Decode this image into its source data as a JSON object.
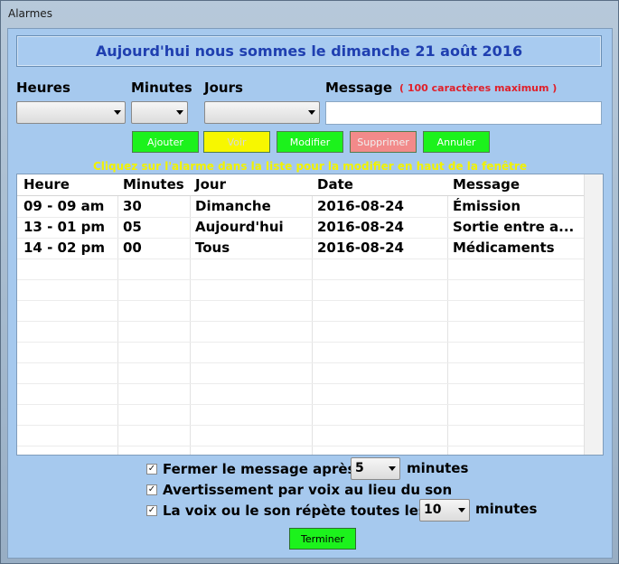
{
  "window": {
    "title": "Alarmes"
  },
  "banner": "Aujourd'hui nous sommes le dimanche 21 août 2016",
  "labels": {
    "heures": "Heures",
    "minutes": "Minutes",
    "jours": "Jours",
    "message": "Message",
    "hint": "( 100 caractères maximum )"
  },
  "buttons": {
    "ajouter": "Ajouter",
    "voir": "Voir",
    "modifier": "Modifier",
    "supprimer": "Supprimer",
    "annuler": "Annuler",
    "terminer": "Terminer"
  },
  "note": "Cliquez sur l'alarme dans la liste pour la modifier en haut de la fenêtre",
  "table": {
    "headers": [
      "Heure",
      "Minutes",
      "Jour",
      "Date",
      "Message"
    ],
    "rows": [
      [
        "09 - 09 am",
        "30",
        "Dimanche",
        "2016-08-24",
        "Émission"
      ],
      [
        "13 - 01 pm",
        "05",
        "Aujourd'hui",
        "2016-08-24",
        "Sortie entre a..."
      ],
      [
        "14 - 02 pm",
        "00",
        "Tous",
        "2016-08-24",
        "Médicaments"
      ]
    ]
  },
  "options": {
    "close_after": "Fermer le message après",
    "close_after_value": "5",
    "voice": "Avertissement par voix au lieu du son",
    "repeat": "La voix ou le son répète toutes les",
    "repeat_value": "10",
    "minutes_unit": "minutes"
  },
  "colors": {
    "banner_text": "#1f3fb0",
    "accent_green": "#1cf21c",
    "hint_red": "#e0202a",
    "note_yellow": "#f2f200"
  }
}
